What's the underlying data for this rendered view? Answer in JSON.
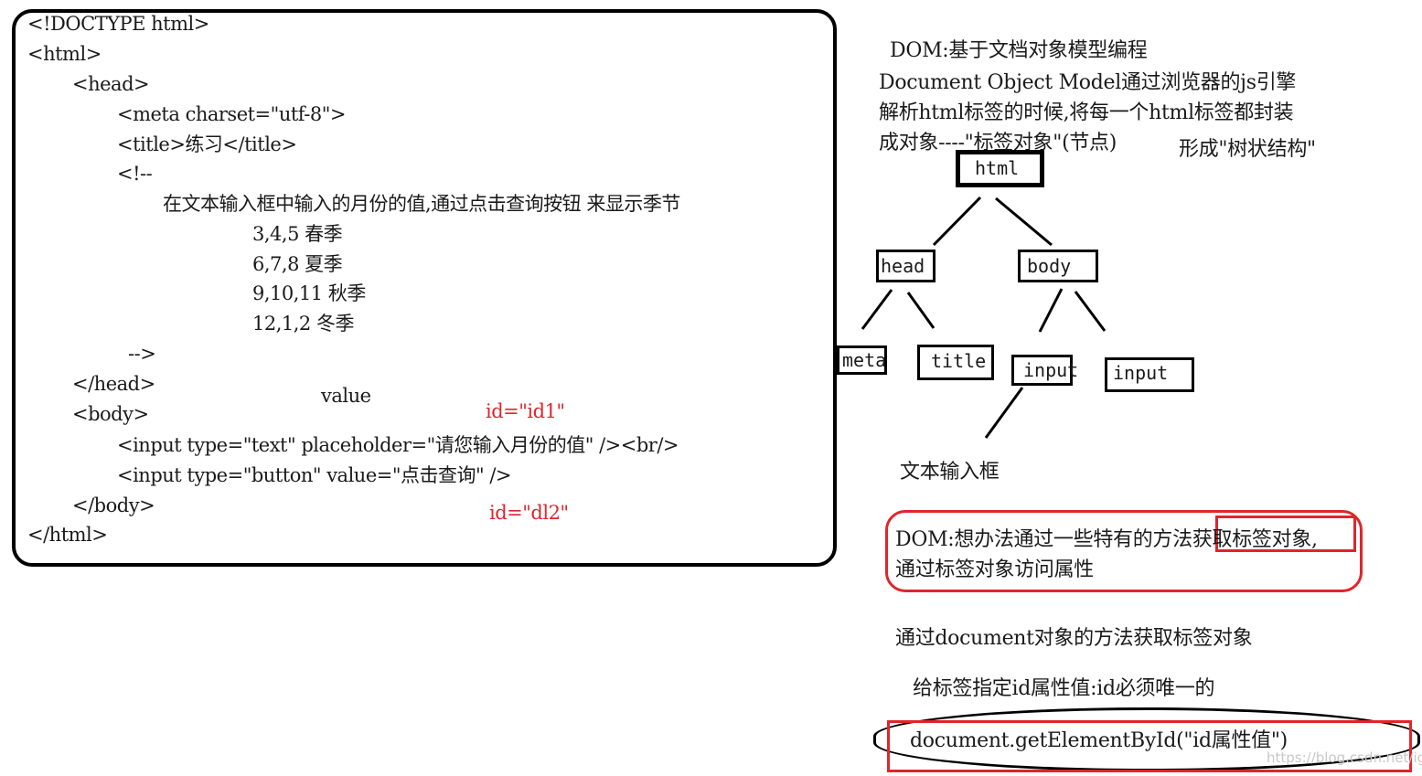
{
  "code_panel": {
    "lines": [
      "<!DOCTYPE html>",
      "<html>",
      "<head>",
      "<meta charset=\"utf-8\">",
      "<title>练习</title>",
      "<!--",
      "在文本输入框中输入的月份的值,通过点击查询按钮 来显示季节",
      "3,4,5 春季",
      "6,7,8 夏季",
      "9,10,11 秋季",
      "12,1,2 冬季",
      "-->",
      "</head>",
      "<body>",
      "<input type=\"text\" placeholder=\"请您输入月份的值\" /><br/>",
      "<input type=\"button\" value=\"点击查询\" />",
      "</body>",
      "</html>"
    ],
    "annotation_value": "value",
    "annotation_id1": "id=\"id1\"",
    "annotation_id2": "id=\"dl2\""
  },
  "explanation": {
    "title": "DOM:基于文档对象模型编程",
    "line1": "Document Object Model通过浏览器的js引擎",
    "line2": "解析html标签的时候,将每一个html标签都封装",
    "line3": "成对象----\"标签对象\"(节点)",
    "line3b": "形成\"树状结构\""
  },
  "tree": {
    "root": "html",
    "head": "head",
    "body": "body",
    "meta": "meta",
    "title": "title",
    "input1": "input",
    "input2": "input",
    "input1_note": "文本输入框"
  },
  "notes": {
    "dom_box_line1": "DOM:想办法通过一些特有的方法获取标签对象,",
    "dom_box_line2": "通过标签对象访问属性",
    "via_document": "通过document对象的方法获取标签对象",
    "id_rule": "给标签指定id属性值:id必须唯一的",
    "method": "document.getElementById(\"id属性值\")",
    "watermark": "https://blog.csdn.net/igff"
  },
  "colors": {
    "accent_red": "#e0252b",
    "border_black": "#000000"
  }
}
